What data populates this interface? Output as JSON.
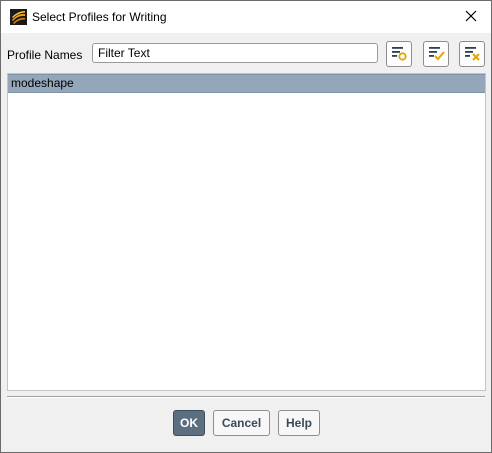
{
  "window": {
    "title": "Select Profiles for Writing"
  },
  "filter": {
    "label": "Profile Names",
    "placeholder": "Filter Text"
  },
  "toolbar": {
    "buttons": [
      {
        "icon": "filter-options-icon"
      },
      {
        "icon": "select-all-icon"
      },
      {
        "icon": "deselect-all-icon"
      }
    ]
  },
  "profiles": {
    "items": [
      {
        "label": "modeshape",
        "selected": true
      }
    ]
  },
  "footer": {
    "ok_label": "OK",
    "cancel_label": "Cancel",
    "help_label": "Help"
  },
  "colors": {
    "selection": "#94a6b9",
    "primary_button": "#5c6f81",
    "icon_accent": "#e0a800",
    "icon_dark": "#2c3e50"
  }
}
